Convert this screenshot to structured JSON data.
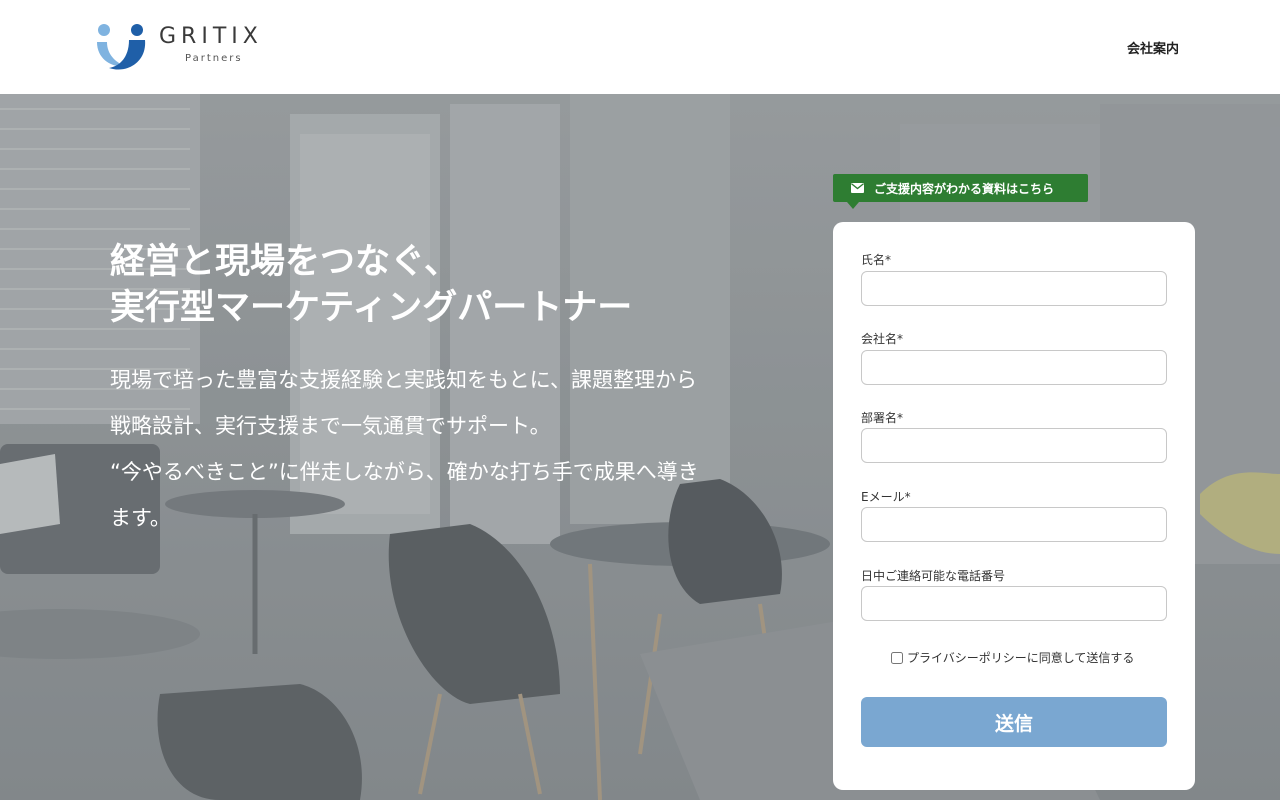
{
  "header": {
    "logo_word": "GRITIX",
    "logo_sub": "Partners",
    "nav_company": "会社案内"
  },
  "hero": {
    "headline": [
      "経営と現場をつなぐ、",
      "実行型マーケティングパートナー"
    ],
    "lead": [
      "現場で培った豊富な支援経験と実践知をもとに、課題整理から",
      "戦略設計、実行支援まで一気通貫でサポート。",
      "“今やるべきこと”に伴走しながら、確かな打ち手で成果へ導き",
      "ます。"
    ]
  },
  "form": {
    "badge": "ご支援内容がわかる資料はこちら",
    "fields": [
      {
        "label": "氏名*"
      },
      {
        "label": "会社名*"
      },
      {
        "label": "部署名*"
      },
      {
        "label": "Eメール*"
      },
      {
        "label": "日中ご連絡可能な電話番号"
      }
    ],
    "consent": "プライバシーポリシーに同意して送信する",
    "submit": "送信"
  },
  "colors": {
    "badge": "#2e7d32",
    "submit": "#7aa7d1",
    "logo_light_blue": "#7fb3e0",
    "logo_dark_blue": "#1f5fa8"
  }
}
